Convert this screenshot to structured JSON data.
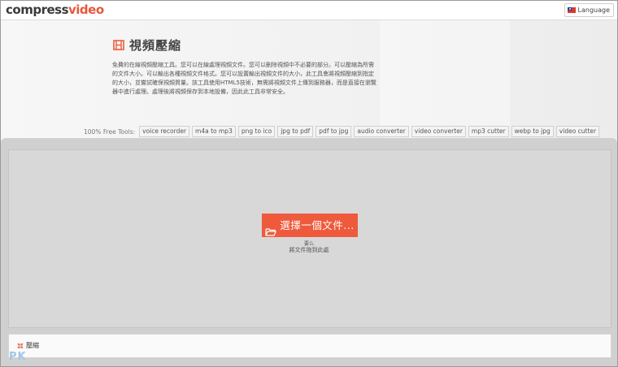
{
  "header": {
    "logo_part1": "compress",
    "logo_part2": "video",
    "language_label": "Language"
  },
  "hero": {
    "title": "視頻壓縮",
    "description": "免費的在線視頻壓縮工具。您可以在線處理視頻文件。您可以刪除視頻中不必要的部分。可以壓縮為所需的文件大小。可以輸出各種視頻文件格式。您可以設置輸出視頻文件的大小，此工具會將視頻壓縮到指定的大小，並嘗試確保視頻質量。該工具使用HTML5技術，無需將視頻文件上傳到服務器，而是直接在瀏覽器中進行處理。處理後將視頻保存到本地設備，因此此工具非常安全。"
  },
  "tools": {
    "label": "100% Free Tools:",
    "items": [
      "voice recorder",
      "m4a to mp3",
      "png to ico",
      "jpg to pdf",
      "pdf to jpg",
      "audio converter",
      "video converter",
      "mp3 cutter",
      "webp to jpg",
      "video cutter"
    ]
  },
  "dropzone": {
    "choose_button": "選擇一個文件...",
    "or_text": "要么",
    "drag_text": "將文件拖到此處"
  },
  "compress": {
    "button_label": "壓縮"
  },
  "watermark": "PK",
  "colors": {
    "accent": "#ee5a3b",
    "logo_dark": "#3a3a3a",
    "drop_bg": "#d0d0d0"
  },
  "icons": {
    "title": "film-icon",
    "choose": "folder-open-icon",
    "compress": "compress-icon",
    "language": "flag-icon"
  }
}
